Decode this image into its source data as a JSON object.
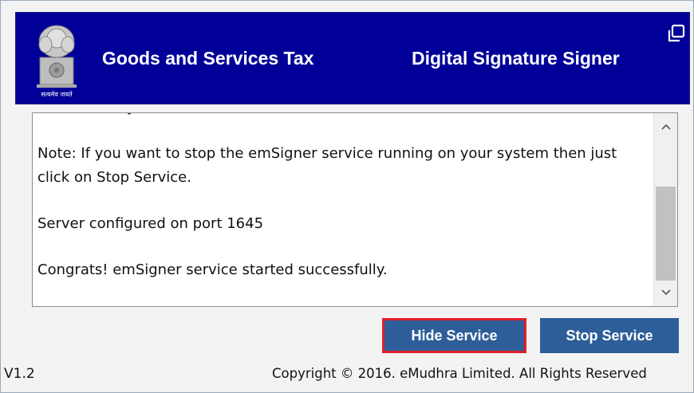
{
  "header": {
    "title_left": "Goods and Services Tax",
    "title_right": "Digital Signature Signer",
    "emblem_caption": "सत्यमेव जयते"
  },
  "log": {
    "lines": [
      "automatically.",
      "Note: If you want to stop the emSigner service running on your system then just click on Stop Service.",
      "Server configured on port 1645",
      "Congrats! emSigner service started successfully."
    ]
  },
  "buttons": {
    "hide_label": "Hide Service",
    "stop_label": "Stop Service"
  },
  "footer": {
    "version": "V1.2",
    "copyright": "Copyright © 2016. eMudhra Limited. All Rights Reserved"
  },
  "colors": {
    "banner": "#000099",
    "button": "#2e5e99",
    "highlight": "#e0202a"
  }
}
